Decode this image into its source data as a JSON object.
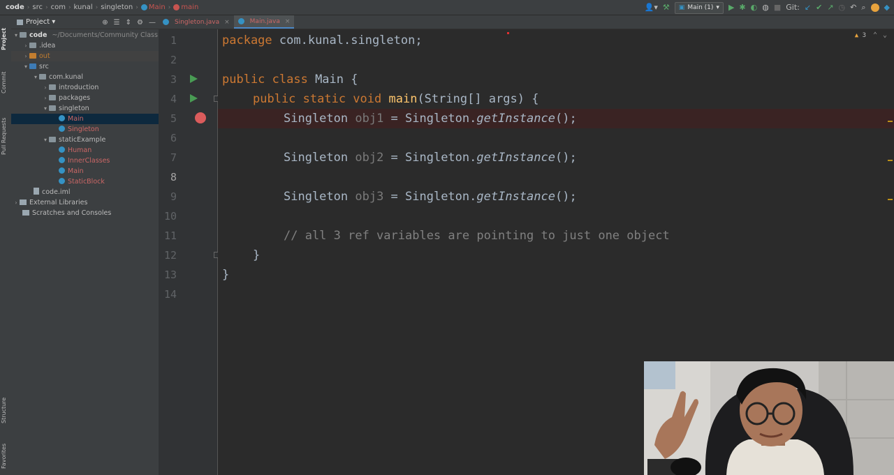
{
  "breadcrumb": [
    "code",
    "src",
    "com",
    "kunal",
    "singleton",
    "Main",
    "main"
  ],
  "toolbar": {
    "run_config": "Main (1)",
    "git_label": "Git:"
  },
  "project_panel": {
    "title": "Project",
    "tree": [
      {
        "label": "code",
        "hint": "~/Documents/Community Class",
        "depth": 0,
        "type": "module"
      },
      {
        "label": ".idea",
        "depth": 1,
        "type": "folder"
      },
      {
        "label": "out",
        "depth": 1,
        "type": "folder-excluded"
      },
      {
        "label": "src",
        "depth": 1,
        "type": "folder-src"
      },
      {
        "label": "com.kunal",
        "depth": 2,
        "type": "package"
      },
      {
        "label": "introduction",
        "depth": 3,
        "type": "package"
      },
      {
        "label": "packages",
        "depth": 3,
        "type": "package"
      },
      {
        "label": "singleton",
        "depth": 3,
        "type": "package"
      },
      {
        "label": "Main",
        "depth": 4,
        "type": "class"
      },
      {
        "label": "Singleton",
        "depth": 4,
        "type": "class"
      },
      {
        "label": "staticExample",
        "depth": 3,
        "type": "package"
      },
      {
        "label": "Human",
        "depth": 4,
        "type": "class"
      },
      {
        "label": "InnerClasses",
        "depth": 4,
        "type": "class"
      },
      {
        "label": "Main",
        "depth": 4,
        "type": "class"
      },
      {
        "label": "StaticBlock",
        "depth": 4,
        "type": "class"
      },
      {
        "label": "code.iml",
        "depth": 1,
        "type": "file"
      },
      {
        "label": "External Libraries",
        "depth": 0,
        "type": "library"
      },
      {
        "label": "Scratches and Consoles",
        "depth": 0,
        "type": "scratch"
      }
    ]
  },
  "side_tabs": {
    "project": "Project",
    "commit": "Commit",
    "pull_requests": "Pull Requests",
    "structure": "Structure",
    "favorites": "Favorites"
  },
  "tabs": [
    {
      "label": "Singleton.java",
      "active": false
    },
    {
      "label": "Main.java",
      "active": true
    }
  ],
  "editor": {
    "warning_count": "3",
    "line_numbers": [
      "1",
      "2",
      "3",
      "4",
      "5",
      "6",
      "7",
      "8",
      "9",
      "10",
      "11",
      "12",
      "13",
      "14"
    ],
    "code": {
      "l1_kw": "package",
      "l1_rest": " com.kunal.singleton;",
      "l3_kw": "public class",
      "l3_rest": " Main {",
      "l4_kw": "public static void",
      "l4_fn": "main",
      "l4_rest": "(String[] args) {",
      "l5_type": "Singleton ",
      "l5_var": "obj1",
      "l5_mid": " = Singleton.",
      "l5_call": "getInstance",
      "l5_end": "();",
      "l7_type": "Singleton ",
      "l7_var": "obj2",
      "l7_mid": " = Singleton.",
      "l7_call": "getInstance",
      "l7_end": "();",
      "l9_type": "Singleton ",
      "l9_var": "obj3",
      "l9_mid": " = Singleton.",
      "l9_call": "getInstance",
      "l9_end": "();",
      "l11_comment": "// all 3 ref variables are pointing to just one object",
      "l12": "}",
      "l13": "}"
    }
  }
}
